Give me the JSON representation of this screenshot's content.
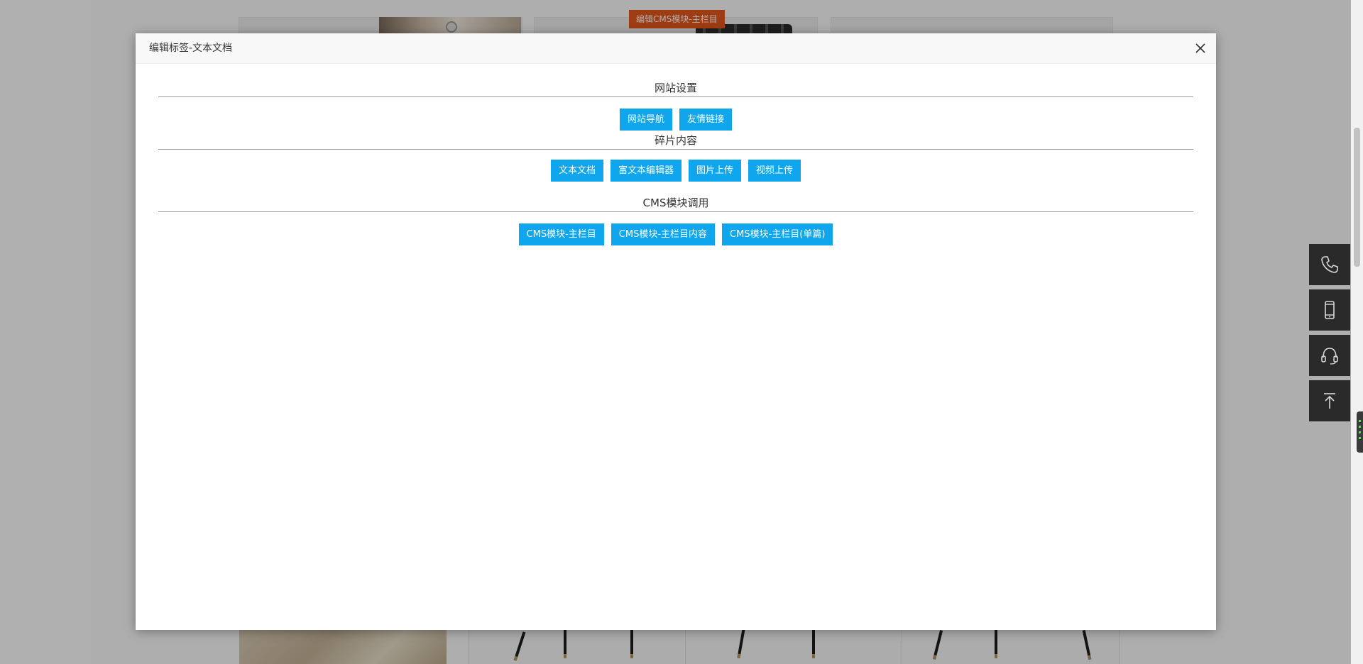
{
  "background": {
    "tag_label": "编辑CMS模块-主栏目"
  },
  "modal": {
    "title": "编辑标签-文本文档",
    "close_icon": "close-icon",
    "sections": [
      {
        "title": "网站设置",
        "buttons": [
          "网站导航",
          "友情链接"
        ]
      },
      {
        "title": "碎片内容",
        "buttons": [
          "文本文档",
          "富文本编辑器",
          "图片上传",
          "视频上传"
        ]
      },
      {
        "title": "CMS模块调用",
        "buttons": [
          "CMS模块-主栏目",
          "CMS模块-主栏目内容",
          "CMS模块-主栏目(单篇)"
        ]
      }
    ]
  },
  "side_tools": [
    "phone-icon",
    "mobile-icon",
    "headset-icon",
    "back-to-top-icon"
  ],
  "colors": {
    "button": "#10a6ee",
    "tag": "#e2561c",
    "side_tool": "#2a2a2a"
  }
}
